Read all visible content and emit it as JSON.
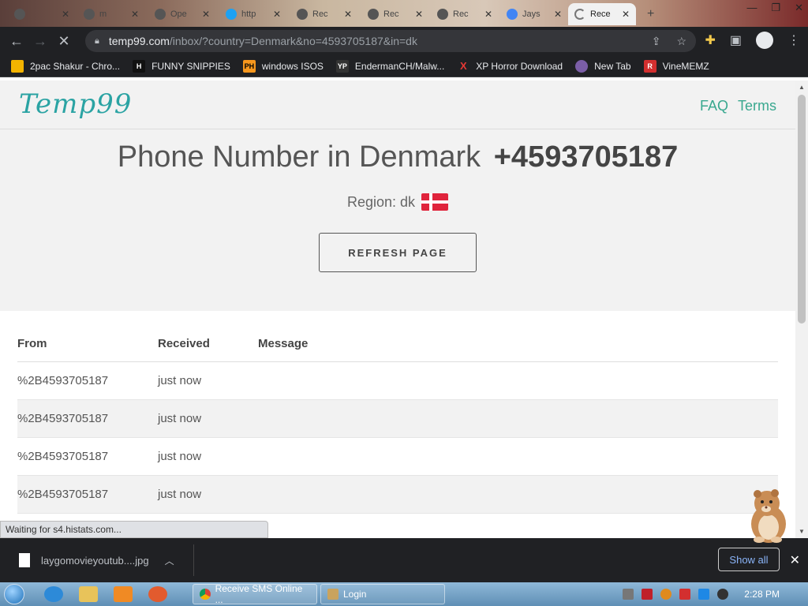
{
  "browser": {
    "tabs": [
      {
        "label": "",
        "icon": "app-icon"
      },
      {
        "label": "m",
        "icon": "app-icon"
      },
      {
        "label": "Ope",
        "icon": "openai-icon"
      },
      {
        "label": "http",
        "icon": "twitter-icon"
      },
      {
        "label": "Rec",
        "icon": "app-icon"
      },
      {
        "label": "Rec",
        "icon": "app-icon"
      },
      {
        "label": "Rec",
        "icon": "app-icon"
      },
      {
        "label": "Jays",
        "icon": "google-icon"
      },
      {
        "label": "Rece",
        "icon": "loading-icon"
      }
    ],
    "url_host": "temp99.com",
    "url_rest": "/inbox/?country=Denmark&no=4593705187&in=dk",
    "bookmarks": [
      {
        "label": "2pac Shakur - Chro...",
        "icon_text": "",
        "color": "#f4b400"
      },
      {
        "label": "FUNNY SNIPPIES",
        "icon_text": "H",
        "color": "#111111"
      },
      {
        "label": "windows ISOS",
        "icon_text": "PH",
        "color": "#f7971d"
      },
      {
        "label": "EndermanCH/Malw...",
        "icon_text": "YP",
        "color": "#333333"
      },
      {
        "label": "XP Horror Download",
        "icon_text": "X",
        "color": "#e53935"
      },
      {
        "label": "New Tab",
        "icon_text": "",
        "color": "#7b5ea7"
      },
      {
        "label": "VineMEMZ",
        "icon_text": "R",
        "color": "#d32f2f"
      }
    ]
  },
  "site": {
    "logo": "Temp99",
    "nav": [
      "FAQ",
      "Terms"
    ],
    "title_prefix": "Phone Number in Denmark",
    "phone": "+4593705187",
    "region_label": "Region: dk",
    "refresh_label": "REFRESH PAGE",
    "table": {
      "headers": [
        "From",
        "Received",
        "Message"
      ],
      "rows": [
        {
          "from": "%2B4593705187",
          "received": "just now",
          "message": ""
        },
        {
          "from": "%2B4593705187",
          "received": "just now",
          "message": ""
        },
        {
          "from": "%2B4593705187",
          "received": "just now",
          "message": ""
        },
        {
          "from": "%2B4593705187",
          "received": "just now",
          "message": ""
        }
      ]
    }
  },
  "status_text": "Waiting for s4.histats.com...",
  "download": {
    "filename": "laygomovieyoutub....jpg",
    "show_all": "Show all"
  },
  "taskbar": {
    "tasks": [
      "Receive SMS Online ...",
      "Login"
    ],
    "clock": "2:28 PM"
  },
  "colors": {
    "accent": "#39a88f",
    "logo": "#2aa3a3",
    "chrome_dark": "#202124"
  }
}
